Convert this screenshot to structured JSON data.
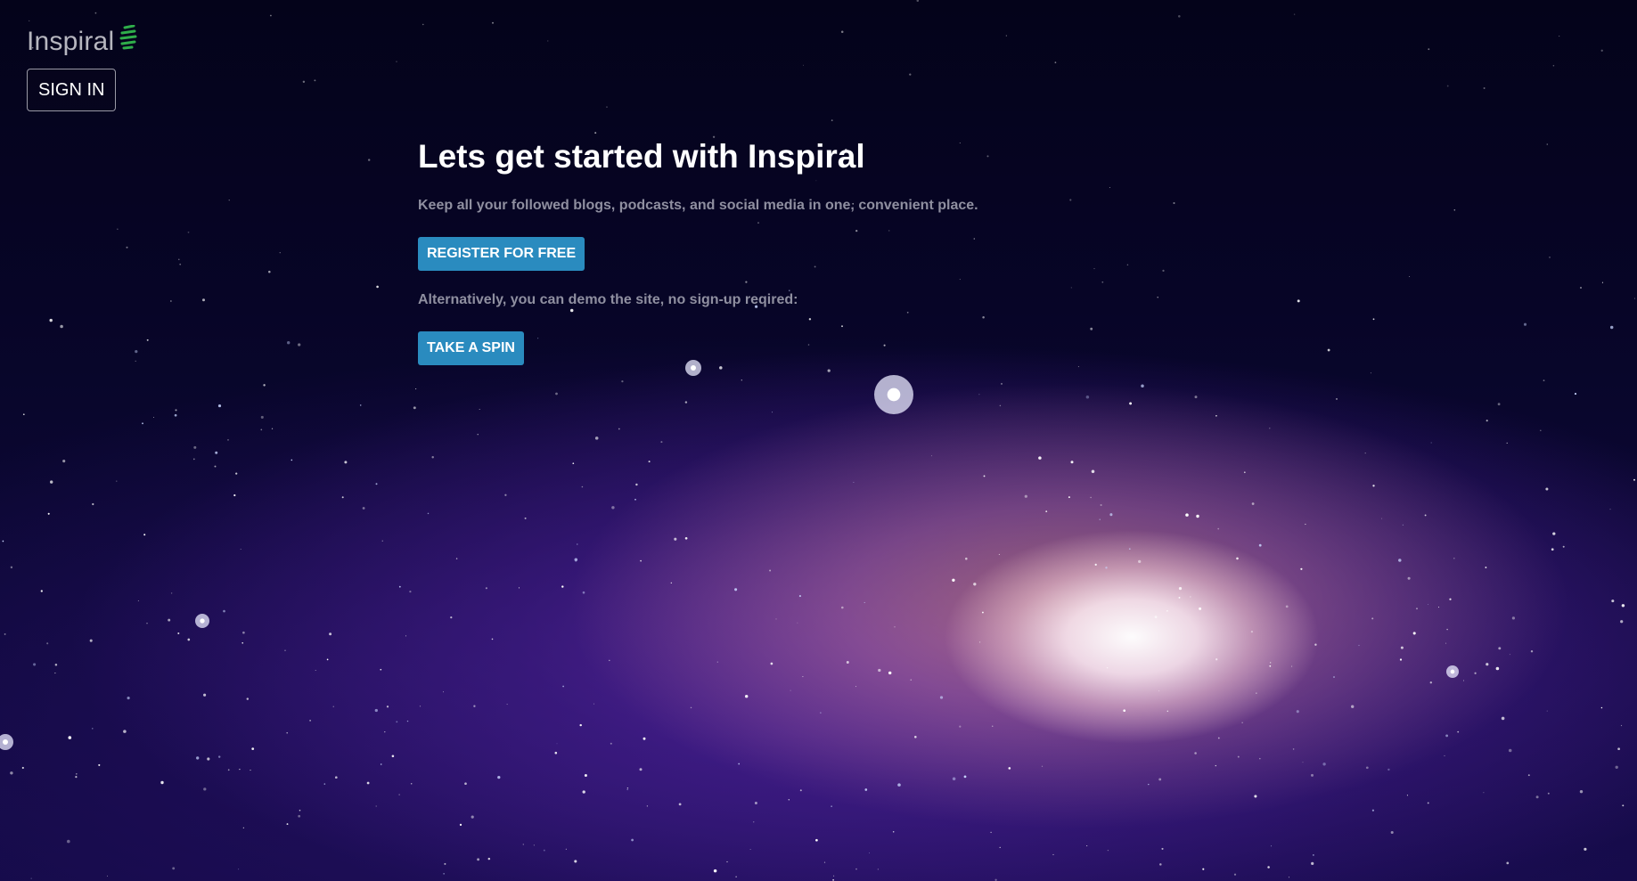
{
  "brand": {
    "name": "Inspiral",
    "icon": "green-spiral-icon",
    "icon_color": "#2fae4a"
  },
  "header": {
    "sign_in_label": "SIGN IN"
  },
  "hero": {
    "title": "Lets get started with Inspiral",
    "subtitle": "Keep all your followed blogs, podcasts, and social media in one, convenient place.",
    "register_label": "REGISTER FOR FREE",
    "alternative_text": "Alternatively, you can demo the site, no sign-up reqired:",
    "demo_label": "TAKE A SPIN"
  },
  "background": {
    "image": "galaxy-background",
    "base_color": "#05031a"
  },
  "colors": {
    "button": "#2a8bbf",
    "muted_text": "#8f8fa0"
  }
}
